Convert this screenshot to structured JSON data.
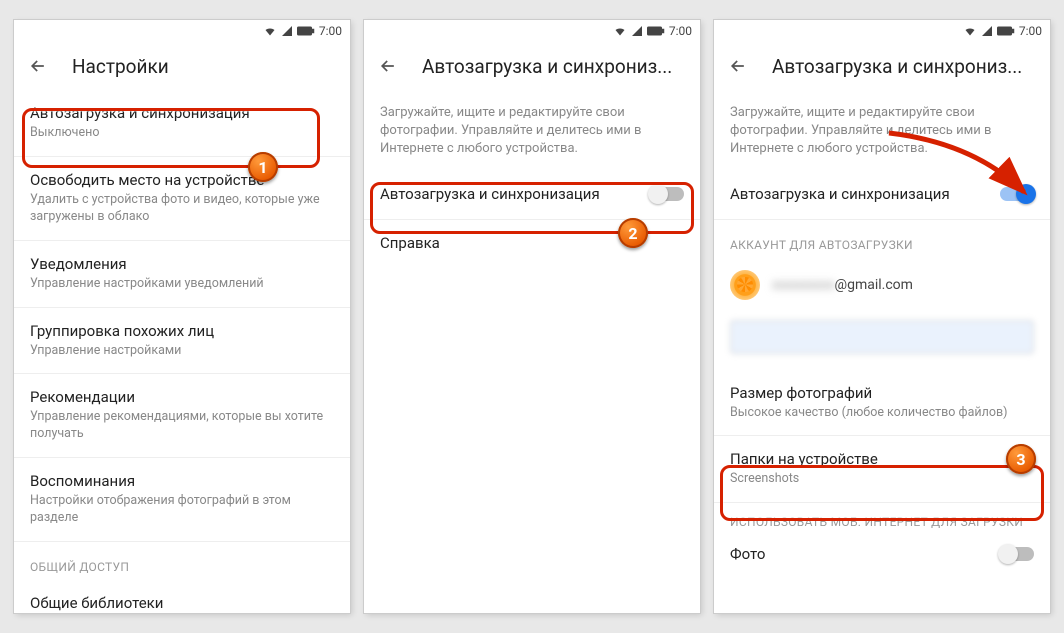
{
  "status": {
    "time": "7:00"
  },
  "screen1": {
    "title": "Настройки",
    "items": [
      {
        "primary": "Автозагрузка и синхронизация",
        "secondary": "Выключено"
      },
      {
        "primary": "Освободить место на устройстве",
        "secondary": "Удалить с устройства фото и видео, которые уже загружены в облако"
      },
      {
        "primary": "Уведомления",
        "secondary": "Управление настройками уведомлений"
      },
      {
        "primary": "Группировка похожих лиц",
        "secondary": "Управление настройками"
      },
      {
        "primary": "Рекомендации",
        "secondary": "Управление рекомендациями, которые вы хотите получать"
      },
      {
        "primary": "Воспоминания",
        "secondary": "Настройки отображения фотографий в этом разделе"
      }
    ],
    "section_cap": "ОБЩИЙ ДОСТУП",
    "shared_label": "Общие библиотеки",
    "marker": "1"
  },
  "screen2": {
    "title": "Автозагрузка и синхрониз...",
    "info": "Загружайте, ищите и редактируйте свои фотографии. Управляйте и делитесь ими в Интернете с любого устройства.",
    "toggle_label": "Автозагрузка и синхронизация",
    "help_label": "Справка",
    "marker": "2"
  },
  "screen3": {
    "title": "Автозагрузка и синхрониз...",
    "info": "Загружайте, ищите и редактируйте свои фотографии. Управляйте и делитесь ими в Интернете с любого устройства.",
    "toggle_label": "Автозагрузка и синхронизация",
    "account_cap": "АККАУНТ ДЛЯ АВТОЗАГРУЗКИ",
    "account_email_suffix": "@gmail.com",
    "size_title": "Размер фотографий",
    "size_sub": "Высокое качество (любое количество файлов)",
    "folders_title": "Папки на устройстве",
    "folders_sub": "Screenshots",
    "mobile_cap": "ИСПОЛЬЗОВАТЬ МОБ. ИНТЕРНЕТ ДЛЯ ЗАГРУЗКИ",
    "photo_label": "Фото",
    "marker": "3"
  }
}
